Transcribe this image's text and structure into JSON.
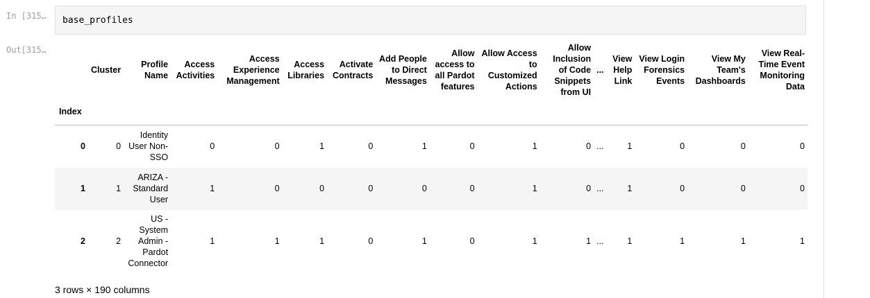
{
  "input_cell": {
    "prompt": "In [315…",
    "code": "base_profiles"
  },
  "output_cell": {
    "prompt": "Out[315…"
  },
  "dataframe": {
    "index_name": "Index",
    "columns": [
      "Cluster",
      "Profile Name",
      "Access Activities",
      "Access Experience Management",
      "Access Libraries",
      "Activate Contracts",
      "Add People to Direct Messages",
      "Allow access to all Pardot features",
      "Allow Access to Customized Actions",
      "Allow Inclusion of Code Snippets from UI",
      "...",
      "View Help Link",
      "View Login Forensics Events",
      "View My Team's Dashboards",
      "View Real-Time Event Monitoring Data"
    ],
    "rows": [
      {
        "index": "0",
        "cells": [
          "0",
          "Identity User Non-SSO",
          "0",
          "0",
          "1",
          "0",
          "1",
          "0",
          "1",
          "0",
          "...",
          "1",
          "0",
          "0",
          "0"
        ]
      },
      {
        "index": "1",
        "cells": [
          "1",
          "ARIZA - Standard User",
          "1",
          "0",
          "0",
          "0",
          "0",
          "0",
          "1",
          "0",
          "...",
          "1",
          "0",
          "0",
          "0"
        ]
      },
      {
        "index": "2",
        "cells": [
          "2",
          "US - System Admin - Pardot Connector",
          "1",
          "1",
          "1",
          "0",
          "1",
          "0",
          "1",
          "1",
          "...",
          "1",
          "1",
          "1",
          "1"
        ]
      }
    ],
    "summary": "3 rows × 190 columns"
  }
}
